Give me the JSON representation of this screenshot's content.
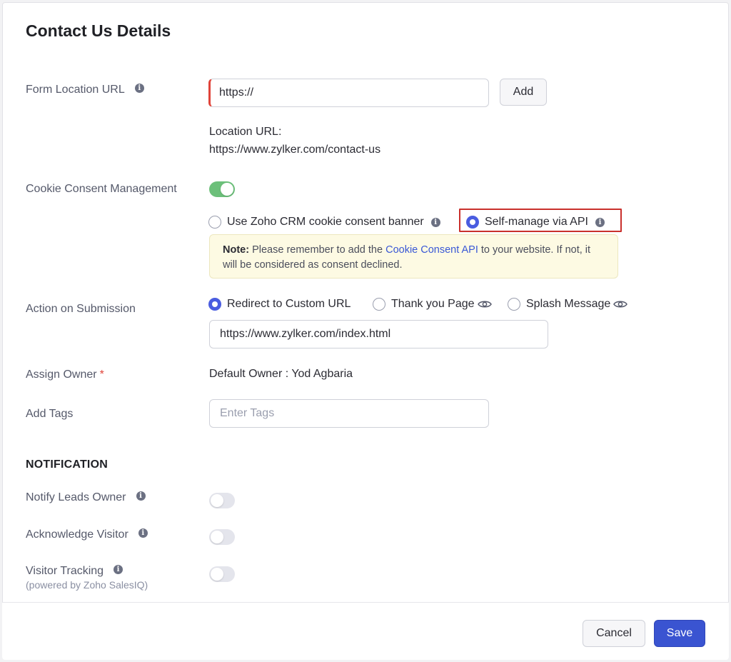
{
  "page": {
    "title": "Contact Us Details"
  },
  "form_location": {
    "label": "Form Location URL",
    "input_value": "https://",
    "add_label": "Add",
    "location_caption": "Location URL:",
    "location_value": "https://www.zylker.com/contact-us"
  },
  "cookie_consent": {
    "label": "Cookie Consent Management",
    "enabled": true,
    "options": [
      {
        "label": "Use Zoho CRM cookie consent banner",
        "selected": false
      },
      {
        "label": "Self-manage via API",
        "selected": true
      }
    ],
    "note": {
      "prefix": "Note:",
      "text_before": " Please remember to add the ",
      "link": "Cookie Consent API",
      "text_after": " to your website. If not, it will be considered as consent declined."
    }
  },
  "action_on_submission": {
    "label": "Action on Submission",
    "options": [
      {
        "label": "Redirect to Custom URL",
        "selected": true
      },
      {
        "label": "Thank you Page",
        "selected": false
      },
      {
        "label": "Splash Message",
        "selected": false
      }
    ],
    "url_value": "https://www.zylker.com/index.html"
  },
  "assign_owner": {
    "label": "Assign Owner",
    "required_mark": "*",
    "value": "Default Owner : Yod Agbaria"
  },
  "add_tags": {
    "label": "Add Tags",
    "placeholder": "Enter Tags"
  },
  "notification": {
    "heading": "NOTIFICATION",
    "items": [
      {
        "label": "Notify Leads Owner",
        "enabled": false
      },
      {
        "label": "Acknowledge Visitor",
        "enabled": false
      },
      {
        "label": "Visitor Tracking",
        "sublabel": "(powered by Zoho SalesIQ)",
        "enabled": false
      }
    ]
  },
  "footer": {
    "cancel_label": "Cancel",
    "save_label": "Save"
  },
  "colors": {
    "primary": "#3a54d1",
    "toggle_on": "#6cc07a",
    "required": "#e0443a",
    "highlight": "#c9302c",
    "note_bg": "#fdfae3"
  }
}
